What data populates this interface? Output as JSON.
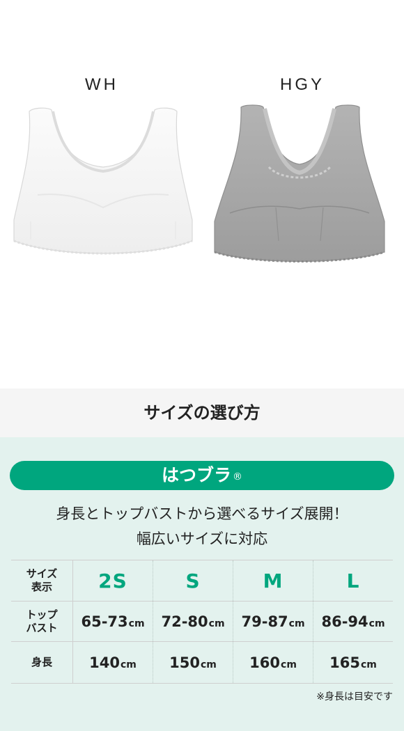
{
  "products": {
    "colors": [
      {
        "code": "WH",
        "swatch": "#ffffff"
      },
      {
        "code": "HGY",
        "swatch": "#a8a8a8"
      }
    ]
  },
  "section": {
    "title": "サイズの選び方"
  },
  "brand": {
    "name": "はつブラ",
    "mark": "®",
    "color": "#00a67e"
  },
  "description": {
    "line1": "身長とトップバストから選べるサイズ展開！",
    "line2": "幅広いサイズに対応"
  },
  "size_table": {
    "row_headers": {
      "size": [
        "サイズ",
        "表示"
      ],
      "bust": [
        "トップ",
        "バスト"
      ],
      "height": "身長"
    },
    "sizes": [
      "2S",
      "S",
      "M",
      "L"
    ],
    "top_bust": [
      "65-73",
      "72-80",
      "79-87",
      "86-94"
    ],
    "height_values": [
      "140",
      "150",
      "160",
      "165"
    ],
    "unit": "cm"
  },
  "note": "※身長は目安です"
}
